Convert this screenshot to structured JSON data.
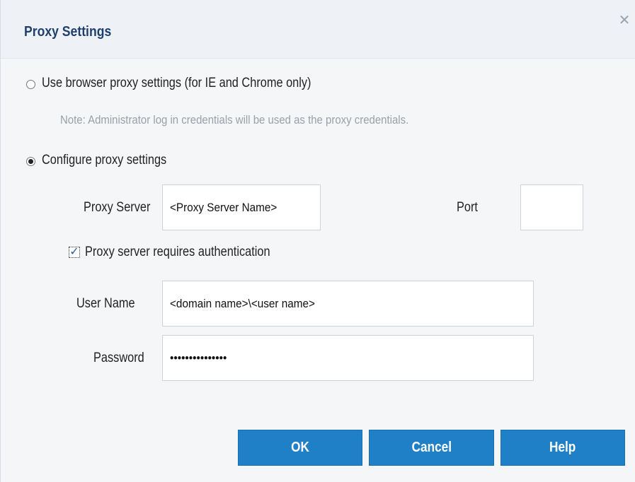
{
  "dialog": {
    "title": "Proxy Settings",
    "close_icon": "close-icon"
  },
  "options": {
    "use_browser": {
      "label": "Use browser proxy settings (for IE and Chrome only)",
      "selected": false,
      "note": "Note: Administrator log in credentials will be used as the proxy credentials."
    },
    "configure": {
      "label": "Configure proxy settings",
      "selected": true
    }
  },
  "proxy": {
    "server_label": "Proxy Server",
    "server_value": "<Proxy Server Name>",
    "port_label": "Port",
    "port_value": ""
  },
  "auth": {
    "checkbox_label": "Proxy server requires authentication",
    "checked": true,
    "username_label": "User Name",
    "username_value": "<domain name>\\<user name>",
    "password_label": "Password",
    "password_value": "•••••••••••••••"
  },
  "buttons": {
    "ok": "OK",
    "cancel": "Cancel",
    "help": "Help"
  },
  "colors": {
    "accent": "#1f7fc7",
    "title": "#1f3f6e"
  }
}
